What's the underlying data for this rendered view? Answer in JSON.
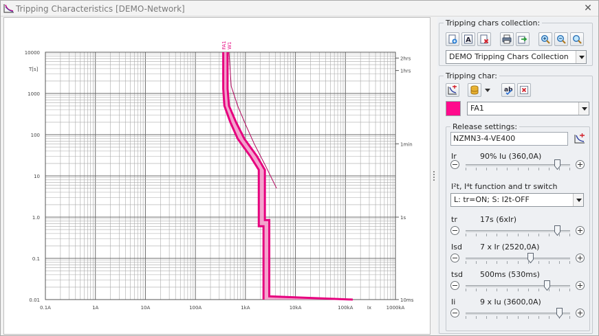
{
  "window": {
    "title": "Tripping Characteristics [DEMO-Network]",
    "close_glyph": "✕"
  },
  "chart": {
    "y_ticks": [
      "10000",
      "1000",
      "100",
      "10",
      "1.0",
      "0.1",
      "0.01"
    ],
    "y_unit": "T[s]",
    "x_ticks": [
      "0.1A",
      "1A",
      "10A",
      "100A",
      "1kA",
      "10kA",
      "100kA",
      "1000kA"
    ],
    "x_unit_label": "Ix",
    "right_labels": [
      "2hrs",
      "1hrs",
      "1min",
      "1s",
      "10ms"
    ],
    "curve_tags": [
      "FA1",
      "W1"
    ],
    "curve_color": "#e6007e"
  },
  "chart_data": {
    "type": "line",
    "xscale": "log",
    "yscale": "log",
    "xlim": [
      0.1,
      1000000
    ],
    "ylim": [
      0.01,
      10000
    ],
    "series": [
      {
        "name": "FA1",
        "kind": "band",
        "lower": [
          [
            360,
            10000
          ],
          [
            360,
            1300
          ],
          [
            380,
            500
          ],
          [
            500,
            200
          ],
          [
            700,
            80
          ],
          [
            1250,
            30
          ],
          [
            1850,
            14
          ],
          [
            1850,
            0.6
          ],
          [
            2300,
            0.6
          ],
          [
            2300,
            0.01
          ]
        ],
        "upper": [
          [
            440,
            10000
          ],
          [
            440,
            1300
          ],
          [
            470,
            500
          ],
          [
            650,
            200
          ],
          [
            950,
            80
          ],
          [
            1700,
            30
          ],
          [
            2450,
            14
          ],
          [
            2450,
            0.85
          ],
          [
            3000,
            0.85
          ],
          [
            3000,
            0.012
          ],
          [
            140000,
            0.01
          ]
        ]
      },
      {
        "name": "W1",
        "kind": "line",
        "points": [
          [
            470,
            10000
          ],
          [
            520,
            1500
          ],
          [
            700,
            500
          ],
          [
            1000,
            180
          ],
          [
            1500,
            60
          ],
          [
            2500,
            18
          ],
          [
            4200,
            5
          ]
        ]
      }
    ]
  },
  "panel": {
    "collection_legend": "Tripping chars collection:",
    "collection_value": "DEMO Tripping Chars Collection",
    "char_legend": "Tripping char:",
    "char_value": "FA1",
    "char_color": "#ff0a8c",
    "release_legend": "Release settings:",
    "release_device": "NZMN3-4-VE400",
    "i2t_label": "I²t, I⁴t function and tr switch",
    "i2t_value": "L: tr=ON; S: I2t-OFF",
    "sliders": [
      {
        "name": "Ir",
        "value": "90% Iu (360,0A)",
        "level": 0.88
      },
      {
        "name": "tr",
        "value": "17s (6xIr)",
        "level": 0.88
      },
      {
        "name": "Isd",
        "value": "7 x Ir (2520,0A)",
        "level": 0.62
      },
      {
        "name": "tsd",
        "value": "500ms (530ms)",
        "level": 0.78
      },
      {
        "name": "Ii",
        "value": "9 x Iu (3600,0A)",
        "level": 0.9
      }
    ]
  }
}
